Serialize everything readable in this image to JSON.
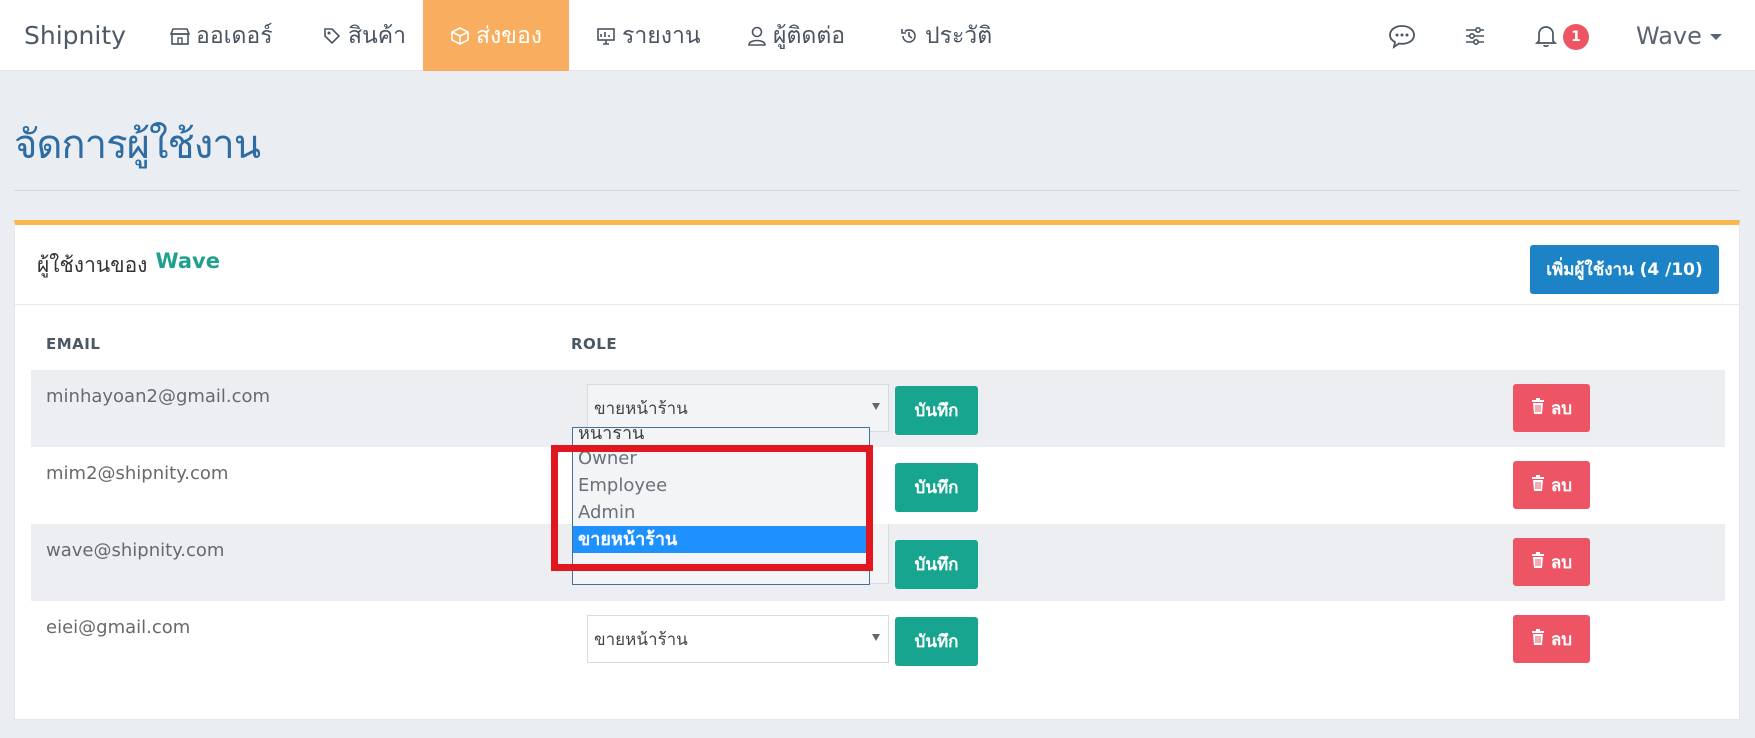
{
  "navbar": {
    "brand": "Shipnity",
    "items": [
      {
        "label": "ออเดอร์",
        "icon": "store-icon"
      },
      {
        "label": "สินค้า",
        "icon": "tags-icon"
      },
      {
        "label": "ส่งของ",
        "icon": "box-icon"
      },
      {
        "label": "รายงาน",
        "icon": "report-icon"
      },
      {
        "label": "ผู้ติดต่อ",
        "icon": "user-icon"
      },
      {
        "label": "ประวัติ",
        "icon": "history-icon"
      }
    ],
    "active_item": "ส่งของ",
    "notification_count": "1",
    "user_name": "Wave"
  },
  "page": {
    "title": "จัดการผู้ใช้งาน"
  },
  "panel": {
    "title_prefix": "ผู้ใช้งานของ",
    "org_name": "Wave",
    "add_user_label": "เพิ่มผู้ใช้งาน (4 /10)"
  },
  "table": {
    "columns": [
      "EMAIL",
      "ROLE"
    ],
    "rows": [
      {
        "email": "minhayoan2@gmail.com",
        "role": "ขายหน้าร้าน",
        "save_label": "บันทึก",
        "delete_label": "ลบ"
      },
      {
        "email": "mim2@shipnity.com",
        "role": "",
        "save_label": "บันทึก",
        "delete_label": "ลบ"
      },
      {
        "email": "wave@shipnity.com",
        "role": "",
        "save_label": "บันทึก",
        "delete_label": "ลบ"
      },
      {
        "email": "eiei@gmail.com",
        "role": "ขายหน้าร้าน",
        "save_label": "บันทึก",
        "delete_label": "ลบ"
      }
    ]
  },
  "dropdown": {
    "options": [
      "หน้าร้าน",
      "Owner",
      "Employee",
      "Admin",
      "ขายหน้าร้าน"
    ],
    "selected": "ขายหน้าร้าน"
  },
  "colors": {
    "active_nav": "#f9ad5e",
    "primary_button": "#1c84c6",
    "save_button": "#18a58f",
    "delete_button": "#ed5565",
    "panel_accent": "#f8b84d",
    "highlight": "#e2161f"
  }
}
